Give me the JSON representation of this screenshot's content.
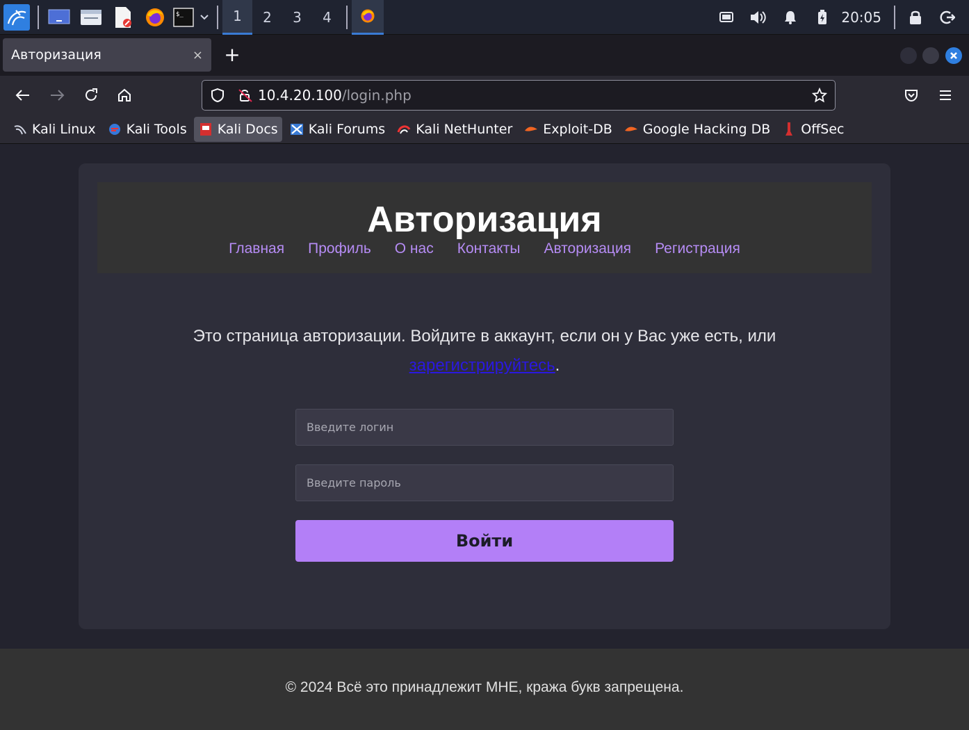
{
  "panel": {
    "workspaces": [
      "1",
      "2",
      "3",
      "4"
    ],
    "active_workspace": "1",
    "clock": "20:05"
  },
  "browser": {
    "tab_title": "Авторизация",
    "tab_close": "×",
    "new_tab": "+",
    "url_host": "10.4.20.100",
    "url_path": "/login.php",
    "bookmarks": [
      {
        "label": "Kali Linux",
        "icon": "kali-dragon-icon"
      },
      {
        "label": "Kali Tools",
        "icon": "kali-tools-icon"
      },
      {
        "label": "Kali Docs",
        "icon": "kali-docs-icon"
      },
      {
        "label": "Kali Forums",
        "icon": "kali-forums-icon"
      },
      {
        "label": "Kali NetHunter",
        "icon": "nethunter-icon"
      },
      {
        "label": "Exploit-DB",
        "icon": "exploitdb-icon"
      },
      {
        "label": "Google Hacking DB",
        "icon": "ghdb-icon"
      },
      {
        "label": "OffSec",
        "icon": "offsec-icon"
      }
    ]
  },
  "site": {
    "title": "Авторизация",
    "nav": [
      "Главная",
      "Профиль",
      "О нас",
      "Контакты",
      "Авторизация",
      "Регистрация"
    ],
    "intro_text": "Это страница авторизации. Войдите в аккаунт, если он у Вас уже есть, или",
    "register_link": "зарегистрируйтесь",
    "intro_end": ".",
    "login_placeholder": "Введите логин",
    "password_placeholder": "Введите пароль",
    "login_button": "Войти",
    "footer": "© 2024 Всё это принадлежит МНЕ, кража букв запрещена."
  },
  "colors": {
    "accent": "#b37ff7",
    "nav_link": "#b68cf5",
    "page_bg": "#23232e",
    "card_bg": "#2e2e3a",
    "header_bg": "#333333"
  }
}
